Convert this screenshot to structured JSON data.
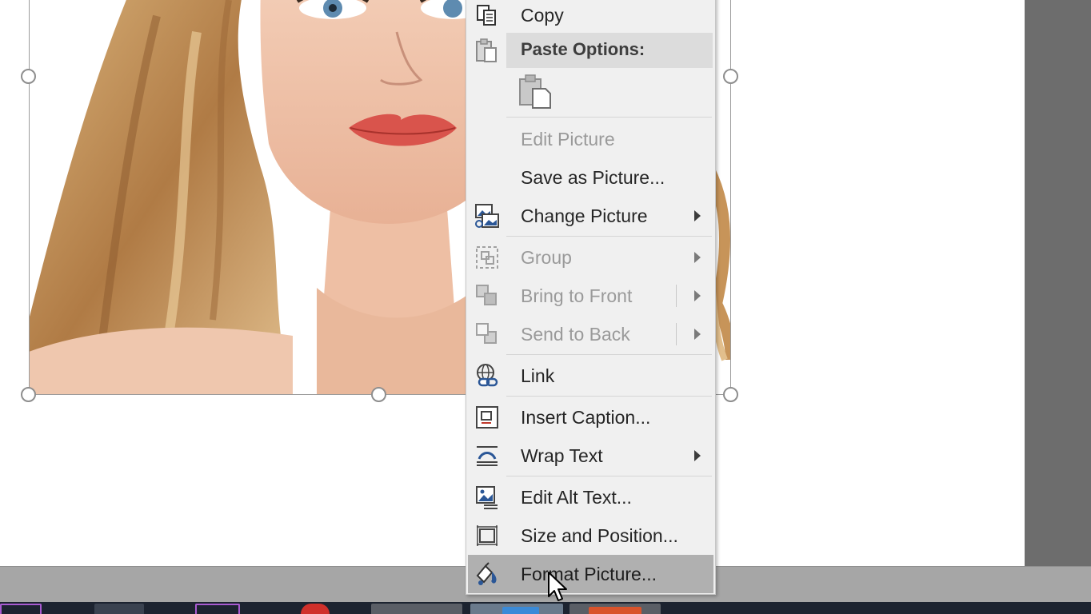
{
  "context_menu": {
    "copy": "Copy",
    "paste_options": "Paste Options:",
    "edit_picture": "Edit Picture",
    "save_as_picture": "Save as Picture...",
    "change_picture": "Change Picture",
    "group": "Group",
    "bring_to_front": "Bring to Front",
    "send_to_back": "Send to Back",
    "link": "Link",
    "insert_caption": "Insert Caption...",
    "wrap_text": "Wrap Text",
    "edit_alt_text": "Edit Alt Text...",
    "size_and_position": "Size and Position...",
    "format_picture": "Format Picture..."
  },
  "icons": {
    "copy": "copy-icon",
    "paste_header": "paste-icon",
    "paste_option": "paste-keep-format-icon",
    "change_picture": "change-picture-icon",
    "group": "group-icon",
    "bring_to_front": "bring-to-front-icon",
    "send_to_back": "send-to-back-icon",
    "link": "link-icon",
    "insert_caption": "insert-caption-icon",
    "wrap_text": "wrap-text-icon",
    "edit_alt_text": "alt-text-icon",
    "size_and_position": "size-position-icon",
    "format_picture": "format-picture-icon"
  },
  "colors": {
    "menu_background": "#f0f0f0",
    "highlight": "#b0b0b0",
    "disabled_text": "#9a9a9a",
    "icon_blue": "#2b5797"
  }
}
